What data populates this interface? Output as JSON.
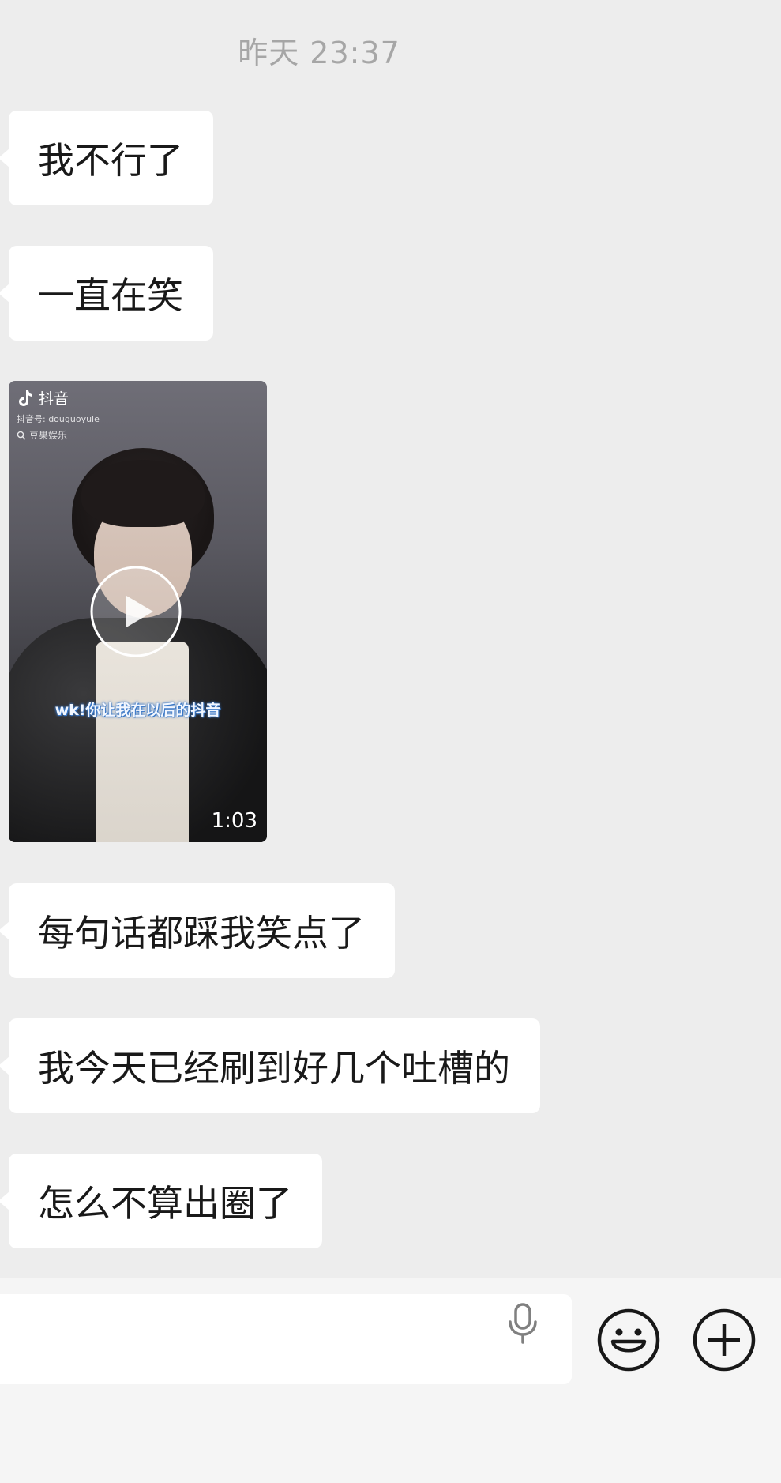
{
  "chat": {
    "timestamp": "昨天 23:37",
    "messages": [
      {
        "type": "text",
        "text": "我不行了"
      },
      {
        "type": "text",
        "text": "一直在笑"
      },
      {
        "type": "video",
        "platform": "抖音",
        "account": "抖音号: douguoyule",
        "music": "豆果娱乐",
        "subtitle": "wk!你让我在以后的抖音",
        "duration": "1:03"
      },
      {
        "type": "text",
        "text": "每句话都踩我笑点了"
      },
      {
        "type": "text",
        "text": "我今天已经刷到好几个吐槽的"
      },
      {
        "type": "text",
        "text": "怎么不算出圈了"
      }
    ]
  },
  "footer": {
    "input_value": "",
    "icons": [
      "mic-icon",
      "emoji-icon",
      "plus-icon"
    ]
  },
  "colors": {
    "background": "#ededed",
    "bubble": "#ffffff",
    "footer": "#f5f5f5",
    "timestamp": "#a6a6a6",
    "text": "#191919"
  }
}
